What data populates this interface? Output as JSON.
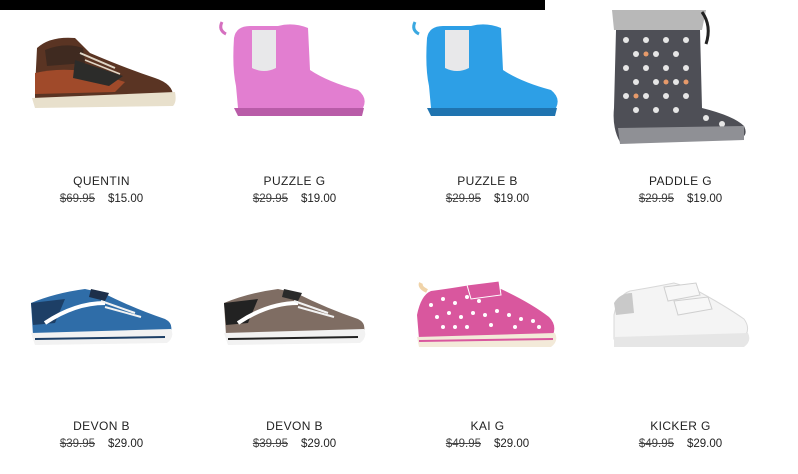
{
  "products": [
    {
      "name": "QUENTIN",
      "old_price": "$69.95",
      "price": "$15.00",
      "image_icon": "brown-high-top-sneaker-icon"
    },
    {
      "name": "PUZZLE G",
      "old_price": "$29.95",
      "price": "$19.00",
      "image_icon": "pink-rain-boot-icon"
    },
    {
      "name": "PUZZLE B",
      "old_price": "$29.95",
      "price": "$19.00",
      "image_icon": "blue-rain-boot-icon"
    },
    {
      "name": "PADDLE G",
      "old_price": "$29.95",
      "price": "$19.00",
      "image_icon": "dotted-gumboot-icon"
    },
    {
      "name": "DEVON B",
      "old_price": "$39.95",
      "price": "$29.00",
      "image_icon": "blue-canvas-sneaker-icon"
    },
    {
      "name": "DEVON B",
      "old_price": "$39.95",
      "price": "$29.00",
      "image_icon": "brown-canvas-sneaker-icon"
    },
    {
      "name": "KAI G",
      "old_price": "$49.95",
      "price": "$29.00",
      "image_icon": "pink-polka-dot-sneaker-icon"
    },
    {
      "name": "KICKER G",
      "old_price": "$49.95",
      "price": "$29.00",
      "image_icon": "white-velcro-sneaker-icon"
    }
  ],
  "colors": {
    "background": "#ffffff",
    "text": "#222222",
    "topbar": "#000000"
  }
}
